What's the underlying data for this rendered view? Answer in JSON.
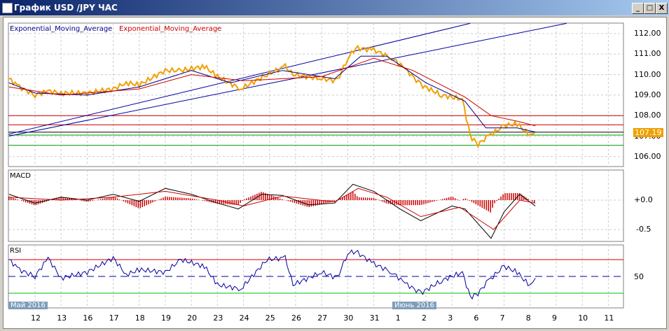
{
  "window": {
    "title": "График USD /JPY  ЧАС",
    "minimize": "_",
    "maximize": "□",
    "close": "X"
  },
  "main": {
    "legend_blue": "Exponential_Moving_Average",
    "legend_red": "Exponential_Moving_Average",
    "price_labels": [
      "112.00",
      "111.00",
      "110.00",
      "109.00",
      "108.00",
      "107.00",
      "106.00"
    ],
    "current_price": "107.19"
  },
  "macd": {
    "label": "MACD",
    "ticks": [
      "+0.0",
      "-0.5"
    ]
  },
  "rsi": {
    "label": "RSI",
    "ticks": [
      "50"
    ]
  },
  "xaxis": {
    "days": [
      "12",
      "13",
      "16",
      "17",
      "18",
      "19",
      "20",
      "23",
      "24",
      "25",
      "26",
      "27",
      "30",
      "31",
      "1",
      "2",
      "3",
      "6",
      "7",
      "8",
      "9",
      "10",
      "11"
    ],
    "month_may": "Май 2016",
    "month_june": "Июнь 2016"
  },
  "colors": {
    "price": "#f0a000",
    "ema_fast": "#00008b",
    "ema_slow": "#cc0000",
    "trend": "#0000a0"
  },
  "chart_data": {
    "type": "line",
    "price": [
      [
        -1,
        109.8
      ],
      [
        -0.6,
        109.4
      ],
      [
        0,
        109.0
      ],
      [
        0.5,
        109.2
      ],
      [
        1,
        109.1
      ],
      [
        2,
        109.1
      ],
      [
        3,
        109.3
      ],
      [
        3.5,
        109.6
      ],
      [
        4,
        109.5
      ],
      [
        5,
        110.2
      ],
      [
        5.6,
        110.2
      ],
      [
        6.5,
        110.4
      ],
      [
        7,
        109.9
      ],
      [
        7.9,
        109.3
      ],
      [
        8.9,
        110.0
      ],
      [
        9.6,
        110.4
      ],
      [
        9.9,
        110.0
      ],
      [
        11,
        109.8
      ],
      [
        11.6,
        109.7
      ],
      [
        12,
        110.8
      ],
      [
        12.3,
        111.3
      ],
      [
        13,
        111.2
      ],
      [
        13.7,
        110.8
      ],
      [
        14.2,
        110.3
      ],
      [
        14.8,
        109.5
      ],
      [
        15.6,
        109.0
      ],
      [
        16.4,
        108.8
      ],
      [
        16.7,
        107.0
      ],
      [
        17,
        106.6
      ],
      [
        17.4,
        107.0
      ],
      [
        18,
        107.5
      ],
      [
        18.5,
        107.6
      ],
      [
        19,
        107.0
      ],
      [
        19.2,
        107.19
      ]
    ],
    "ema_fast": [
      [
        -1,
        109.6
      ],
      [
        0,
        109.1
      ],
      [
        2,
        109.0
      ],
      [
        4,
        109.4
      ],
      [
        6,
        110.2
      ],
      [
        7.5,
        109.6
      ],
      [
        9.5,
        110.2
      ],
      [
        11.5,
        109.8
      ],
      [
        12.5,
        110.9
      ],
      [
        13.5,
        110.9
      ],
      [
        15,
        109.6
      ],
      [
        16.5,
        108.7
      ],
      [
        17.3,
        107.4
      ],
      [
        18.5,
        107.4
      ],
      [
        19.2,
        107.2
      ]
    ],
    "ema_slow": [
      [
        -1,
        109.4
      ],
      [
        1,
        109.0
      ],
      [
        4,
        109.3
      ],
      [
        6,
        110.0
      ],
      [
        8,
        109.7
      ],
      [
        11,
        109.9
      ],
      [
        13,
        110.8
      ],
      [
        14.5,
        110.2
      ],
      [
        16.5,
        108.9
      ],
      [
        17.5,
        108.0
      ],
      [
        18.6,
        107.7
      ],
      [
        19.2,
        107.5
      ]
    ],
    "macd": [
      [
        -1,
        0.1
      ],
      [
        0,
        -0.05
      ],
      [
        1,
        0.05
      ],
      [
        2,
        0.0
      ],
      [
        3,
        0.1
      ],
      [
        4,
        -0.02
      ],
      [
        5,
        0.2
      ],
      [
        6,
        0.1
      ],
      [
        7,
        -0.05
      ],
      [
        7.8,
        -0.15
      ],
      [
        8.7,
        0.1
      ],
      [
        9.5,
        0.08
      ],
      [
        10.5,
        -0.08
      ],
      [
        11.5,
        -0.05
      ],
      [
        12.2,
        0.27
      ],
      [
        13,
        0.15
      ],
      [
        14,
        -0.15
      ],
      [
        14.8,
        -0.35
      ],
      [
        16,
        -0.1
      ],
      [
        16.5,
        -0.15
      ],
      [
        17.5,
        -0.65
      ],
      [
        18,
        -0.2
      ],
      [
        18.6,
        0.1
      ],
      [
        19.2,
        -0.1
      ]
    ],
    "macd_signal": [
      [
        -1,
        0.05
      ],
      [
        1,
        0.0
      ],
      [
        3,
        0.05
      ],
      [
        5,
        0.15
      ],
      [
        7,
        0.0
      ],
      [
        8,
        -0.1
      ],
      [
        9.5,
        0.07
      ],
      [
        11.5,
        -0.03
      ],
      [
        12.4,
        0.2
      ],
      [
        13.5,
        0.05
      ],
      [
        14.8,
        -0.28
      ],
      [
        16.3,
        -0.12
      ],
      [
        17.6,
        -0.5
      ],
      [
        18.6,
        0.0
      ],
      [
        19.2,
        -0.05
      ]
    ],
    "rsi": [
      [
        -1,
        70
      ],
      [
        -0.6,
        58
      ],
      [
        0,
        50
      ],
      [
        0.5,
        72
      ],
      [
        1,
        48
      ],
      [
        2,
        55
      ],
      [
        3,
        72
      ],
      [
        3.5,
        52
      ],
      [
        4,
        58
      ],
      [
        5,
        55
      ],
      [
        5.6,
        70
      ],
      [
        6.5,
        62
      ],
      [
        7,
        40
      ],
      [
        7.9,
        35
      ],
      [
        8.9,
        70
      ],
      [
        9.6,
        72
      ],
      [
        9.9,
        40
      ],
      [
        11,
        55
      ],
      [
        11.6,
        48
      ],
      [
        12,
        78
      ],
      [
        12.3,
        80
      ],
      [
        13,
        65
      ],
      [
        13.7,
        55
      ],
      [
        14.2,
        42
      ],
      [
        14.8,
        30
      ],
      [
        15.6,
        45
      ],
      [
        16.4,
        55
      ],
      [
        16.7,
        25
      ],
      [
        17,
        30
      ],
      [
        17.4,
        45
      ],
      [
        18,
        62
      ],
      [
        18.5,
        55
      ],
      [
        19,
        38
      ],
      [
        19.2,
        48
      ]
    ],
    "price_ylim": [
      105.5,
      112.5
    ],
    "macd_ylim": [
      -0.75,
      0.45
    ],
    "rsi_levels": [
      70,
      50,
      30
    ],
    "hlines": [
      {
        "price": 108.0,
        "color": "#cc0000"
      },
      {
        "price": 107.55,
        "color": "#cc0000"
      },
      {
        "price": 107.19,
        "color": "#000000"
      },
      {
        "price": 107.05,
        "color": "#00a000"
      },
      {
        "price": 106.55,
        "color": "#00a000"
      }
    ],
    "trendlines": [
      [
        [
          -1,
          107.1
        ],
        [
          16.7,
          112.5
        ]
      ],
      [
        [
          -1,
          107.0
        ],
        [
          20.4,
          112.5
        ]
      ]
    ]
  }
}
